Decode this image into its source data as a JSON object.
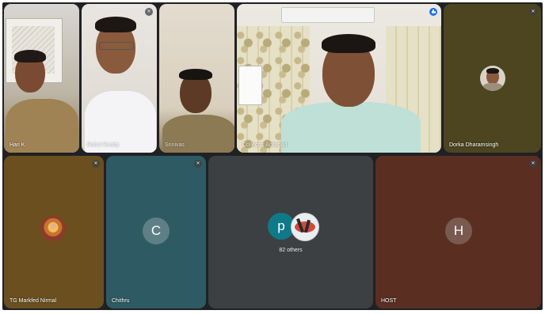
{
  "meeting": {
    "tiles": [
      {
        "id": "hari",
        "name": "Hari K",
        "muted": false
      },
      {
        "id": "p2",
        "name": "Rahul Reddy",
        "muted": true
      },
      {
        "id": "p3",
        "name": "Srinivas",
        "muted": false
      },
      {
        "id": "collector",
        "name": "Collector Adilabad",
        "muted": false,
        "speaking": true
      },
      {
        "id": "dorka",
        "name": "Dorka Dharamsingh",
        "muted": true
      },
      {
        "id": "tg",
        "name": "TG Markfed Nirmal",
        "muted": true
      },
      {
        "id": "chithru",
        "name": "Chithru",
        "muted": true,
        "initial": "C"
      },
      {
        "id": "others",
        "initial": "p",
        "others_label": "82 others"
      },
      {
        "id": "host",
        "name": "HOST",
        "muted": true,
        "initial": "H"
      }
    ]
  },
  "colors": {
    "grid_bg": "#202124",
    "speaking_outline": "#8ab4f8",
    "tile_brown": "#6b4f1f",
    "tile_teal": "#2e5a63",
    "tile_gray": "#3c4043",
    "tile_rust": "#5a2f22",
    "tile_olive": "#4d4520",
    "avatar_teal": "#0f7a87"
  },
  "icons": {
    "mute": "mic-off-icon",
    "speaking": "audio-bars-icon"
  }
}
